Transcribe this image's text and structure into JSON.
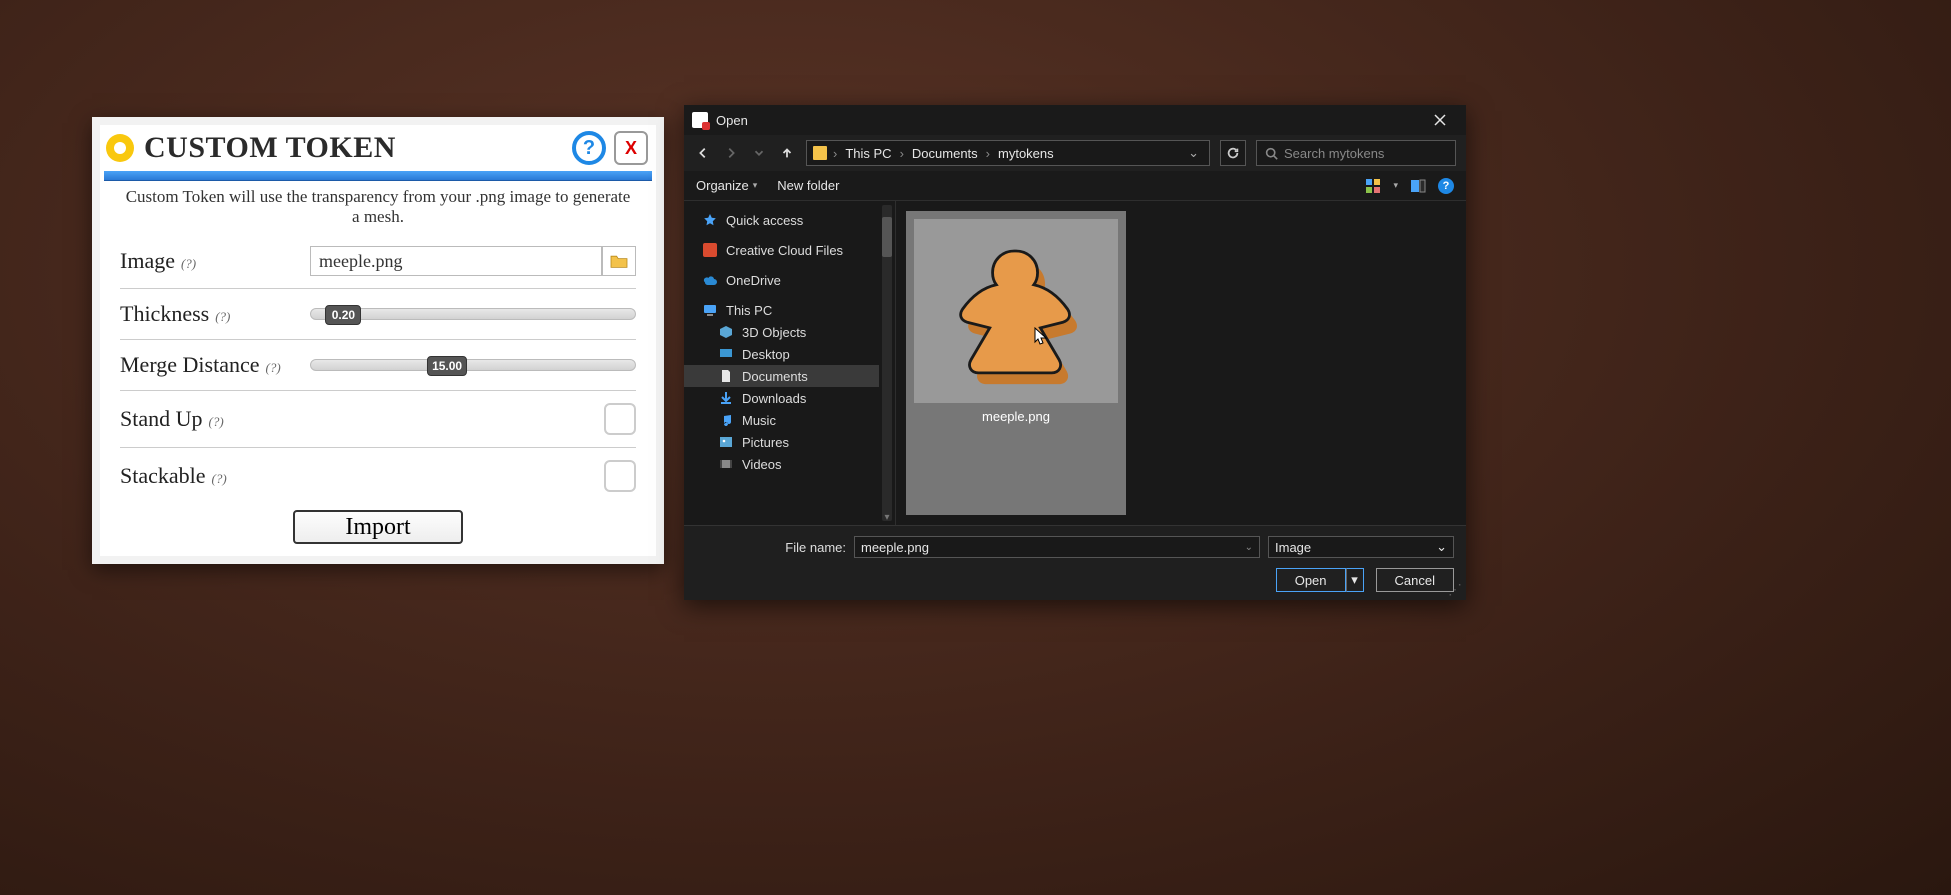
{
  "custom_token": {
    "title": "CUSTOM TOKEN",
    "help_glyph": "?",
    "close_glyph": "X",
    "description": "Custom Token will use the transparency from your .png image to generate a mesh.",
    "hint_glyph": "(?)",
    "image": {
      "label": "Image",
      "value": "meeple.png"
    },
    "thickness": {
      "label": "Thickness",
      "value": "0.20"
    },
    "merge_distance": {
      "label": "Merge Distance",
      "value": "15.00"
    },
    "stand_up": {
      "label": "Stand Up",
      "checked": false
    },
    "stackable": {
      "label": "Stackable",
      "checked": false
    },
    "import_label": "Import"
  },
  "file_open": {
    "title": "Open",
    "breadcrumb": [
      "This PC",
      "Documents",
      "mytokens"
    ],
    "search_placeholder": "Search mytokens",
    "toolbar": {
      "organize": "Organize",
      "new_folder": "New folder"
    },
    "tree": {
      "quick_access": "Quick access",
      "creative_cloud": "Creative Cloud Files",
      "onedrive": "OneDrive",
      "this_pc": "This PC",
      "children": {
        "objects3d": "3D Objects",
        "desktop": "Desktop",
        "documents": "Documents",
        "downloads": "Downloads",
        "music": "Music",
        "pictures": "Pictures",
        "videos": "Videos"
      }
    },
    "files": [
      {
        "name": "meeple.png"
      }
    ],
    "footer": {
      "file_name_label": "File name:",
      "file_name_value": "meeple.png",
      "filter": "Image",
      "open": "Open",
      "cancel": "Cancel"
    }
  }
}
